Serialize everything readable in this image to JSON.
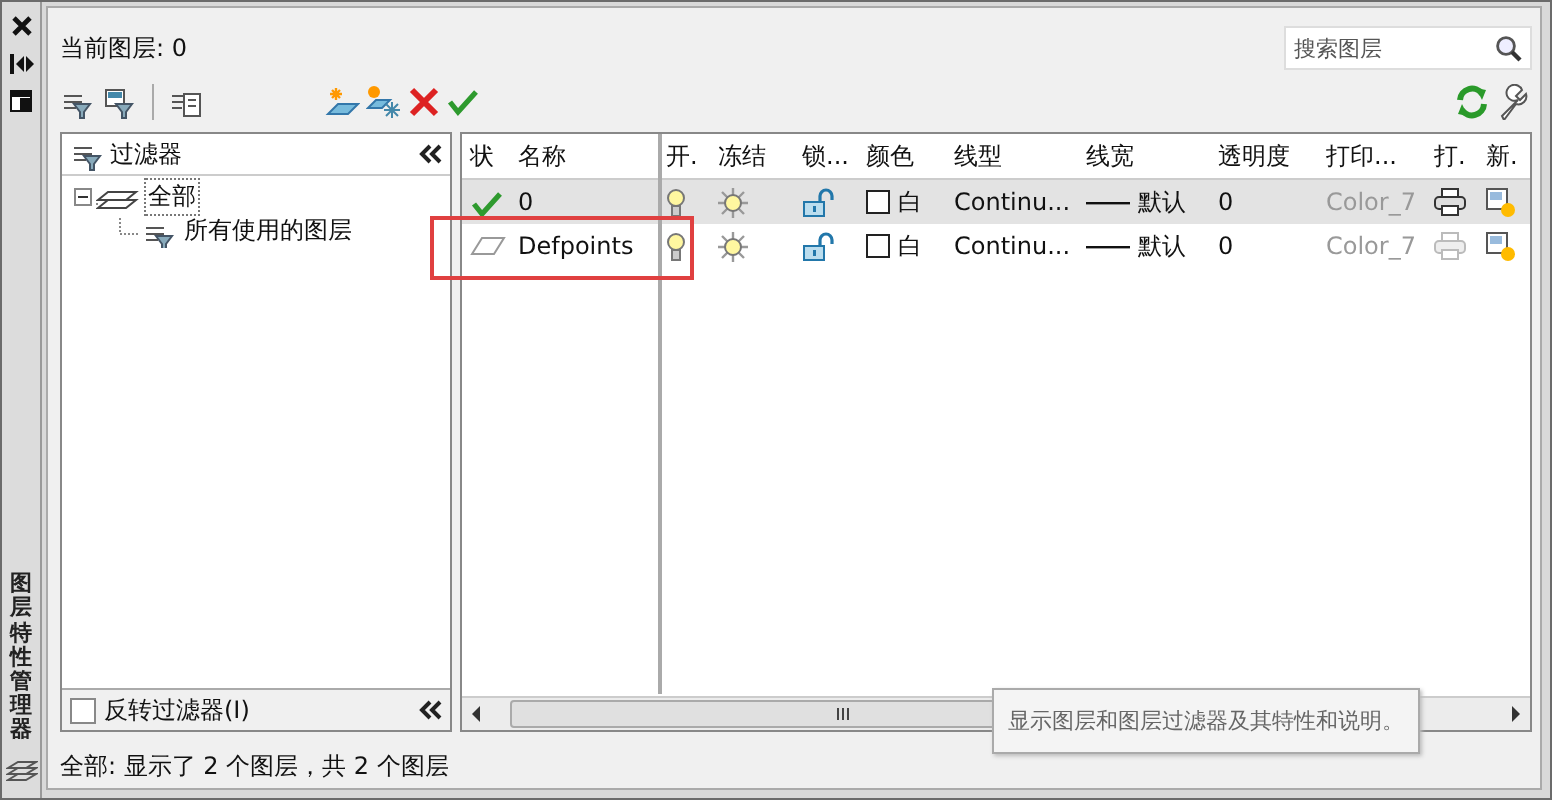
{
  "side_title": "图层特性管理器",
  "title": "当前图层: 0",
  "search": {
    "placeholder": "搜索图层"
  },
  "filters": {
    "header": "过滤器",
    "tree": [
      {
        "label": "全部",
        "expanded": true,
        "selected": true,
        "children": [
          {
            "label": "所有使用的图层",
            "selected": false
          }
        ]
      }
    ],
    "invert": {
      "label": "反转过滤器(I)",
      "checked": false
    }
  },
  "layers": {
    "columns": [
      "状",
      "名称",
      "开.",
      "冻结",
      "锁...",
      "颜色",
      "线型",
      "线宽",
      "透明度",
      "打印...",
      "打.",
      "新."
    ],
    "rows": [
      {
        "current": true,
        "selected": true,
        "highlighted": false,
        "name": "0",
        "on": true,
        "frozen": false,
        "locked": false,
        "color_name": "白",
        "linetype": "Continu...",
        "lineweight": "默认",
        "transparency": "0",
        "plot_style": "Color_7",
        "plot": true
      },
      {
        "current": false,
        "selected": false,
        "highlighted": true,
        "name": "Defpoints",
        "on": true,
        "frozen": false,
        "locked": false,
        "color_name": "白",
        "linetype": "Continu...",
        "lineweight": "默认",
        "transparency": "0",
        "plot_style": "Color_7",
        "plot": false
      }
    ]
  },
  "tooltip": "显示图层和图层过滤器及其特性和说明。",
  "status_bar": "全部: 显示了 2 个图层，共 2 个图层"
}
